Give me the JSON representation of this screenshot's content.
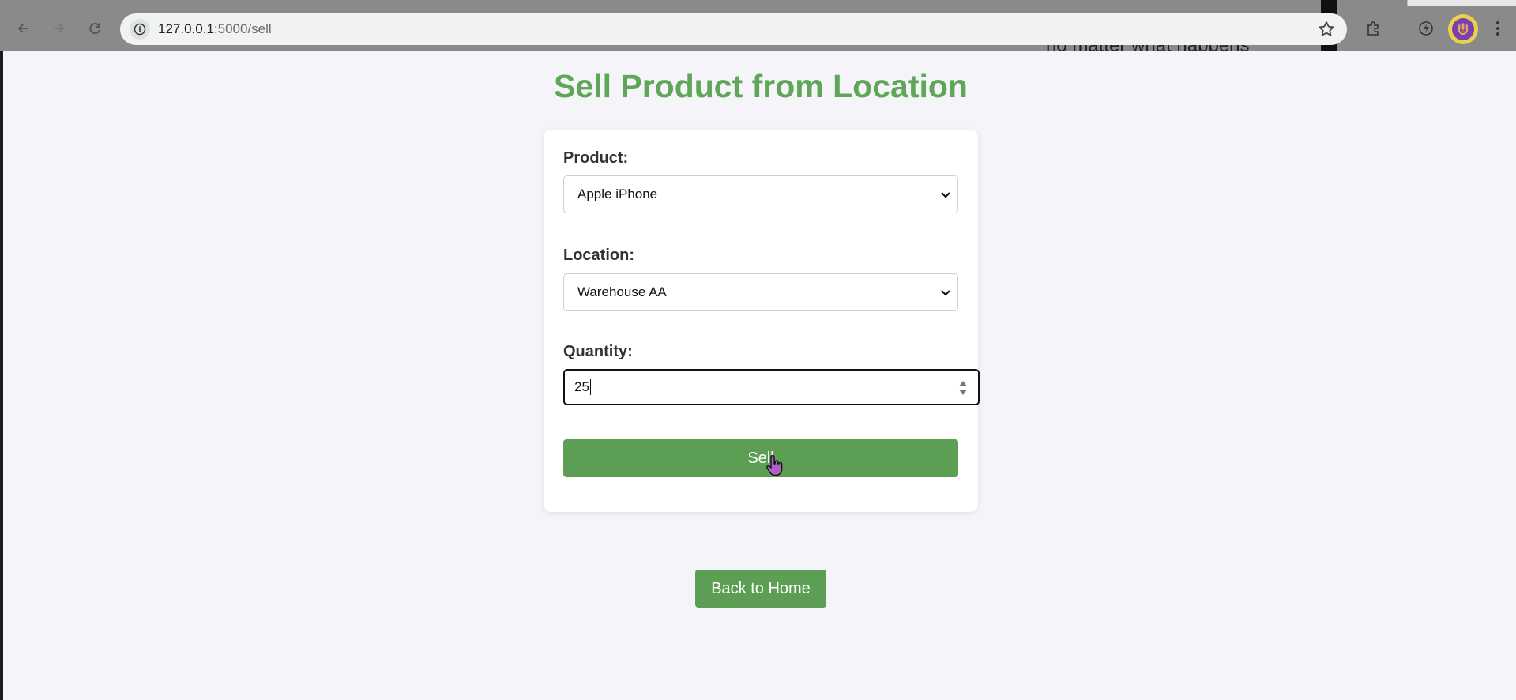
{
  "browser": {
    "url_host": "127.0.0.1",
    "url_path": ":5000/sell",
    "background_text": "no matter what happens"
  },
  "page": {
    "title": "Sell Product from Location"
  },
  "form": {
    "product_label": "Product:",
    "product_value": "Apple iPhone",
    "location_label": "Location:",
    "location_value": "Warehouse AA",
    "quantity_label": "Quantity:",
    "quantity_value": "25",
    "submit_label": "Sell"
  },
  "footer": {
    "back_label": "Back to Home"
  },
  "colors": {
    "accent": "#5c9e53",
    "title": "#5fa659",
    "background": "#f4f4f9"
  }
}
